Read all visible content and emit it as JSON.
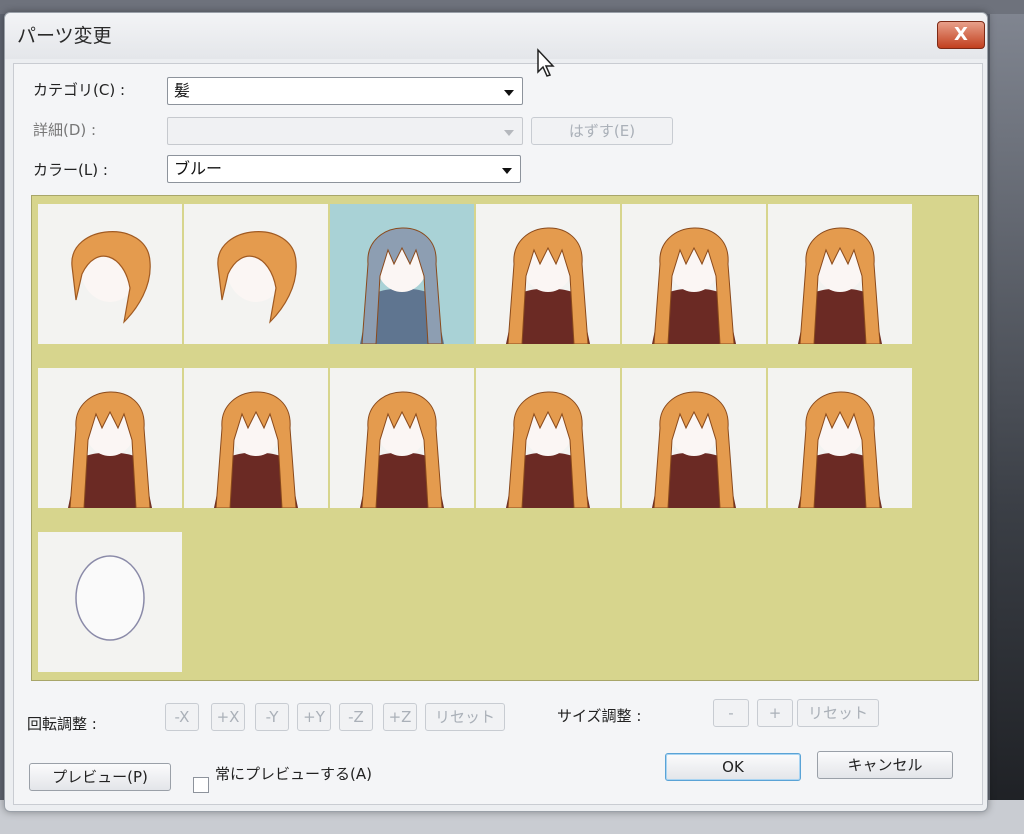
{
  "dialog": {
    "title": "パーツ変更",
    "close_label": "X"
  },
  "form": {
    "category_label": "カテゴリ(C) :",
    "category_value": "髪",
    "detail_label": "詳細(D) :",
    "detail_value": "",
    "remove_button": "はずす(E)",
    "color_label": "カラー(L) :",
    "color_value": "ブルー"
  },
  "parts": {
    "selected_index": 2,
    "items": [
      {
        "name": "short-bob-orange",
        "hair": "#e49b4e"
      },
      {
        "name": "short-messy-orange",
        "hair": "#e49b4e"
      },
      {
        "name": "long-straight-blue",
        "hair": "#8d9eb2"
      },
      {
        "name": "long-bangs-orange",
        "hair": "#e49b4e"
      },
      {
        "name": "long-bangs-orange",
        "hair": "#e49b4e"
      },
      {
        "name": "long-bangs-orange",
        "hair": "#e49b4e"
      },
      {
        "name": "long-bangs-orange",
        "hair": "#e49b4e"
      },
      {
        "name": "long-bangs-orange",
        "hair": "#e49b4e"
      },
      {
        "name": "long-bangs-orange",
        "hair": "#e49b4e"
      },
      {
        "name": "long-wavy-orange",
        "hair": "#e49b4e"
      },
      {
        "name": "long-bangs-orange",
        "hair": "#e49b4e"
      },
      {
        "name": "long-bangs-orange",
        "hair": "#e49b4e"
      },
      {
        "name": "no-hair-outline",
        "hair": "none"
      }
    ]
  },
  "rotation": {
    "label": "回転調整 :",
    "buttons": [
      "-X",
      "+X",
      "-Y",
      "+Y",
      "-Z",
      "+Z",
      "リセット"
    ]
  },
  "size": {
    "label": "サイズ調整 :",
    "buttons": [
      "-",
      "+",
      "リセット"
    ]
  },
  "footer": {
    "preview_button": "プレビュー(P)",
    "always_preview_label": "常にプレビューする(A)",
    "always_preview_checked": false,
    "ok_button": "OK",
    "cancel_button": "キャンセル"
  },
  "colors": {
    "grid_bg": "#d7d58d",
    "selected_tile": "#a9d2d6",
    "hair_orange": "#e49b4e",
    "hair_blue": "#8d9eb2",
    "body_dark": "#6b2a24",
    "close_red": "#c2401f"
  }
}
